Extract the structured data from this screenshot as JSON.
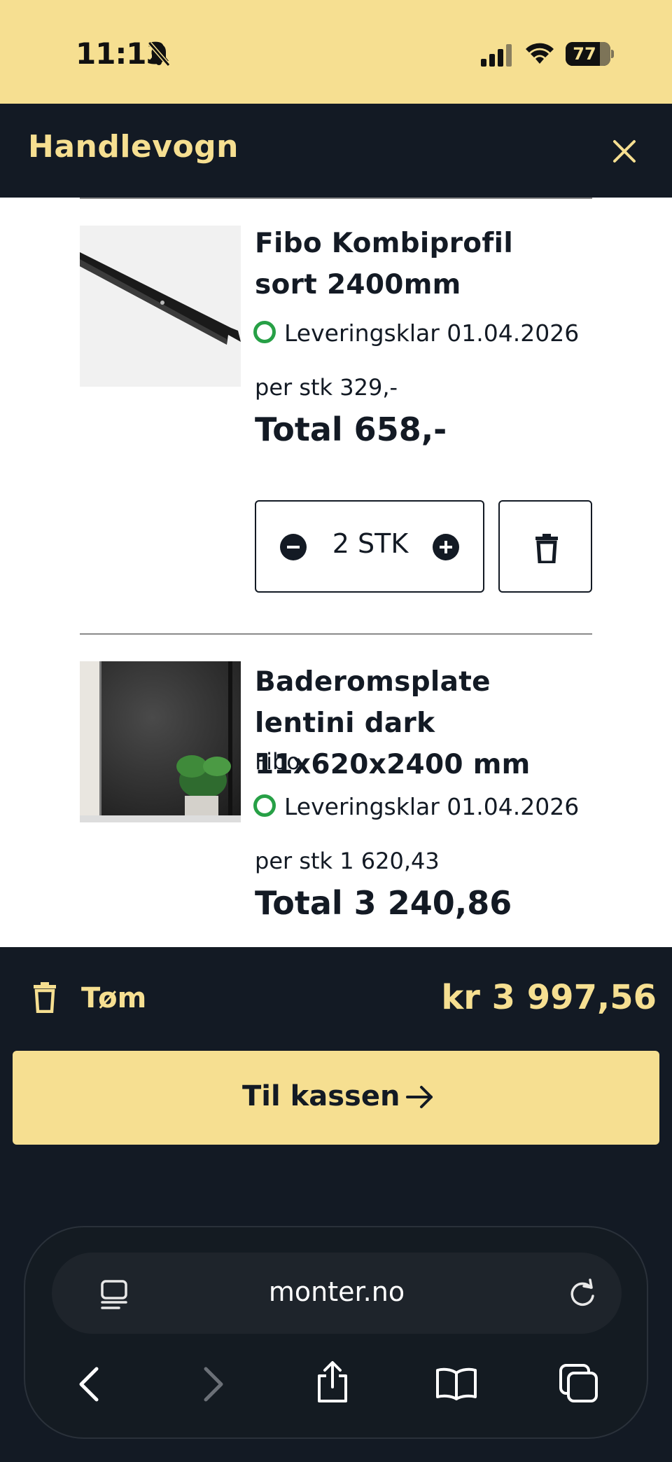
{
  "status_bar": {
    "time": "11:13",
    "battery_level": "77",
    "battery_fraction": 0.77,
    "icons": [
      "bell-slash-icon",
      "signal-icon",
      "wifi-icon",
      "battery-icon"
    ]
  },
  "header": {
    "title": "Handlevogn",
    "close_icon": "close-icon"
  },
  "colors": {
    "accent": "#f6df91",
    "dark": "#131a24",
    "in_stock": "#27a046"
  },
  "items": [
    {
      "name": "Fibo Kombiprofil sort 2400mm",
      "brand": "",
      "stock": "Leveringsklar 01.04.2026",
      "unit_price": "per stk 329,-",
      "total": "Total 658,-",
      "quantity": "2 STK"
    },
    {
      "name": "Baderomsplate lentini dark 11x620x2400 mm",
      "brand": "Fibo",
      "stock": "Leveringsklar 01.04.2026",
      "unit_price": "per stk 1 620,43",
      "total": "Total 3 240,86"
    }
  ],
  "footer": {
    "empty_label": "Tøm",
    "sum": "kr 3 997,56",
    "checkout_label": "Til kassen"
  },
  "browser": {
    "url": "monter.no",
    "nav_icons": [
      "back-icon",
      "forward-icon",
      "share-icon",
      "bookmarks-icon",
      "tabs-icon"
    ]
  }
}
